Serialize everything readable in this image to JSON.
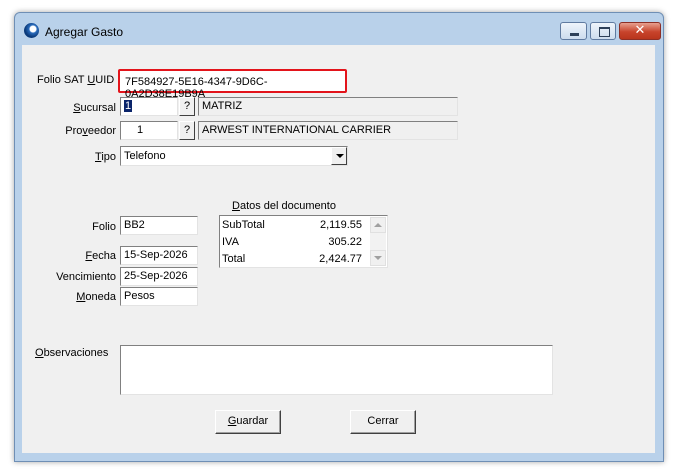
{
  "window": {
    "title": "Agregar Gasto",
    "close_glyph": "✕"
  },
  "form": {
    "folio_sat_uuid": {
      "label_prefix": "Folio SAT ",
      "label_accel": "U",
      "label_suffix": "UID",
      "value": "7F584927-5E16-4347-9D6C-0A2D38E19B9A"
    },
    "sucursal": {
      "label_accel": "S",
      "label_rest": "ucursal",
      "code": "1",
      "lookup_label": "?",
      "name": "MATRIZ"
    },
    "proveedor": {
      "label_prefix": "Pro",
      "label_accel": "v",
      "label_suffix": "eedor",
      "code": "1",
      "lookup_label": "?",
      "name": "ARWEST INTERNATIONAL CARRIER"
    },
    "tipo": {
      "label_accel": "T",
      "label_rest": "ipo",
      "value": "Telefono"
    },
    "folio": {
      "label": "Folio",
      "value": "BB2"
    },
    "fecha": {
      "label_accel": "F",
      "label_rest": "echa",
      "value": "15-Sep-2026"
    },
    "vencimiento": {
      "label": "Vencimiento",
      "value": "25-Sep-2026"
    },
    "moneda": {
      "label_accel": "M",
      "label_rest": "oneda",
      "value": "Pesos"
    },
    "observaciones": {
      "label_accel": "O",
      "label_rest": "bservaciones",
      "value": ""
    }
  },
  "documento": {
    "title_accel": "D",
    "title_rest": "atos del documento",
    "rows": [
      {
        "name": "SubTotal",
        "value": "2,119.55"
      },
      {
        "name": "IVA",
        "value": "305.22"
      },
      {
        "name": "Total",
        "value": "2,424.77"
      }
    ]
  },
  "buttons": {
    "guardar": {
      "accel": "G",
      "rest": "uardar"
    },
    "cerrar": {
      "label": "Cerrar"
    }
  },
  "colors": {
    "highlight_border": "#e3141b",
    "window_frame": "#b9d1ea",
    "dialog_bg": "#f0f0f0"
  },
  "icons": [
    "app-icon",
    "minimize-icon",
    "maximize-icon",
    "close-icon",
    "chevron-down-icon",
    "scroll-up-icon",
    "scroll-down-icon"
  ]
}
